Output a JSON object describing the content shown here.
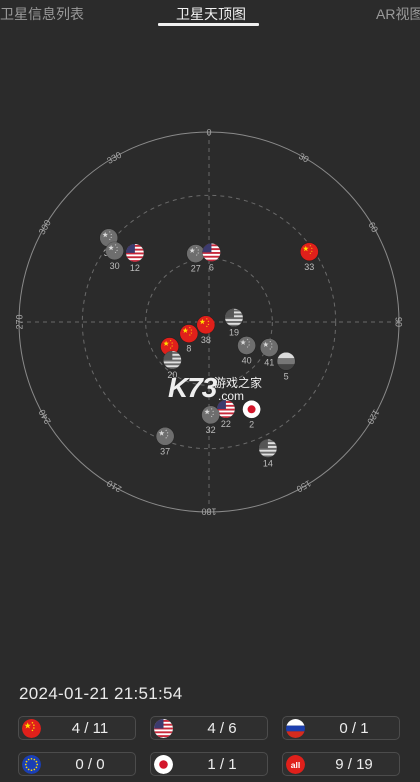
{
  "tabs": [
    {
      "label": "卫星信息列表",
      "active": false
    },
    {
      "label": "卫星天顶图",
      "active": true
    },
    {
      "label": "AR视图",
      "active": false
    }
  ],
  "skyplot": {
    "degree_labels": [
      "0",
      "30",
      "60",
      "90",
      "120",
      "150",
      "180",
      "210",
      "240",
      "270",
      "300",
      "330"
    ],
    "satellites": [
      {
        "id": "33",
        "constellation": "china",
        "azimuth": 55,
        "elevation": 32
      },
      {
        "id": "36",
        "constellation": "china-gray",
        "azimuth": 310,
        "elevation": 28
      },
      {
        "id": "30",
        "constellation": "china-gray",
        "azimuth": 307,
        "elevation": 34
      },
      {
        "id": "12",
        "constellation": "usa",
        "azimuth": 313,
        "elevation": 42
      },
      {
        "id": "27",
        "constellation": "china-gray",
        "azimuth": 349,
        "elevation": 57
      },
      {
        "id": "6",
        "constellation": "usa",
        "azimuth": 2,
        "elevation": 57
      },
      {
        "id": "19",
        "constellation": "usa-gray",
        "azimuth": 80,
        "elevation": 78
      },
      {
        "id": "38",
        "constellation": "china",
        "azimuth": 228,
        "elevation": 88
      },
      {
        "id": "40",
        "constellation": "china-gray",
        "azimuth": 122,
        "elevation": 69
      },
      {
        "id": "41",
        "constellation": "china-gray",
        "azimuth": 113,
        "elevation": 59
      },
      {
        "id": "5",
        "constellation": "russia-gray",
        "azimuth": 117,
        "elevation": 49
      },
      {
        "id": "8",
        "constellation": "china",
        "azimuth": 240,
        "elevation": 79
      },
      {
        "id": "13",
        "constellation": "china",
        "azimuth": 238,
        "elevation": 68
      },
      {
        "id": "20",
        "constellation": "usa-gray",
        "azimuth": 224,
        "elevation": 65
      },
      {
        "id": "2",
        "constellation": "japan",
        "azimuth": 154,
        "elevation": 44
      },
      {
        "id": "22",
        "constellation": "usa",
        "azimuth": 169,
        "elevation": 48
      },
      {
        "id": "32",
        "constellation": "china-gray",
        "azimuth": 179,
        "elevation": 46
      },
      {
        "id": "14",
        "constellation": "usa-gray",
        "azimuth": 155,
        "elevation": 24
      },
      {
        "id": "37",
        "constellation": "china-gray",
        "azimuth": 201,
        "elevation": 32
      }
    ]
  },
  "watermark": {
    "logo": "K73",
    "cn": "游戏之家",
    "domain": ".com"
  },
  "timestamp": "2024-01-21   21:51:54",
  "stats": [
    {
      "constellation": "china",
      "count": "4 / 11"
    },
    {
      "constellation": "usa",
      "count": "4 / 6"
    },
    {
      "constellation": "russia",
      "count": "0 / 1"
    },
    {
      "constellation": "eu",
      "count": "0 / 0"
    },
    {
      "constellation": "japan",
      "count": "1 / 1"
    },
    {
      "constellation": "all",
      "count": "9 / 19",
      "badge": "all"
    }
  ],
  "colors": {
    "background": "#2b2b2b",
    "china": "#e0201b",
    "china_star": "#ffde00",
    "usa_red": "#c8283a",
    "usa_blue": "#3c3b6e",
    "russia_blue": "#1c3fae",
    "eu_blue": "#1a3fb5",
    "japan_red": "#d3152a"
  }
}
